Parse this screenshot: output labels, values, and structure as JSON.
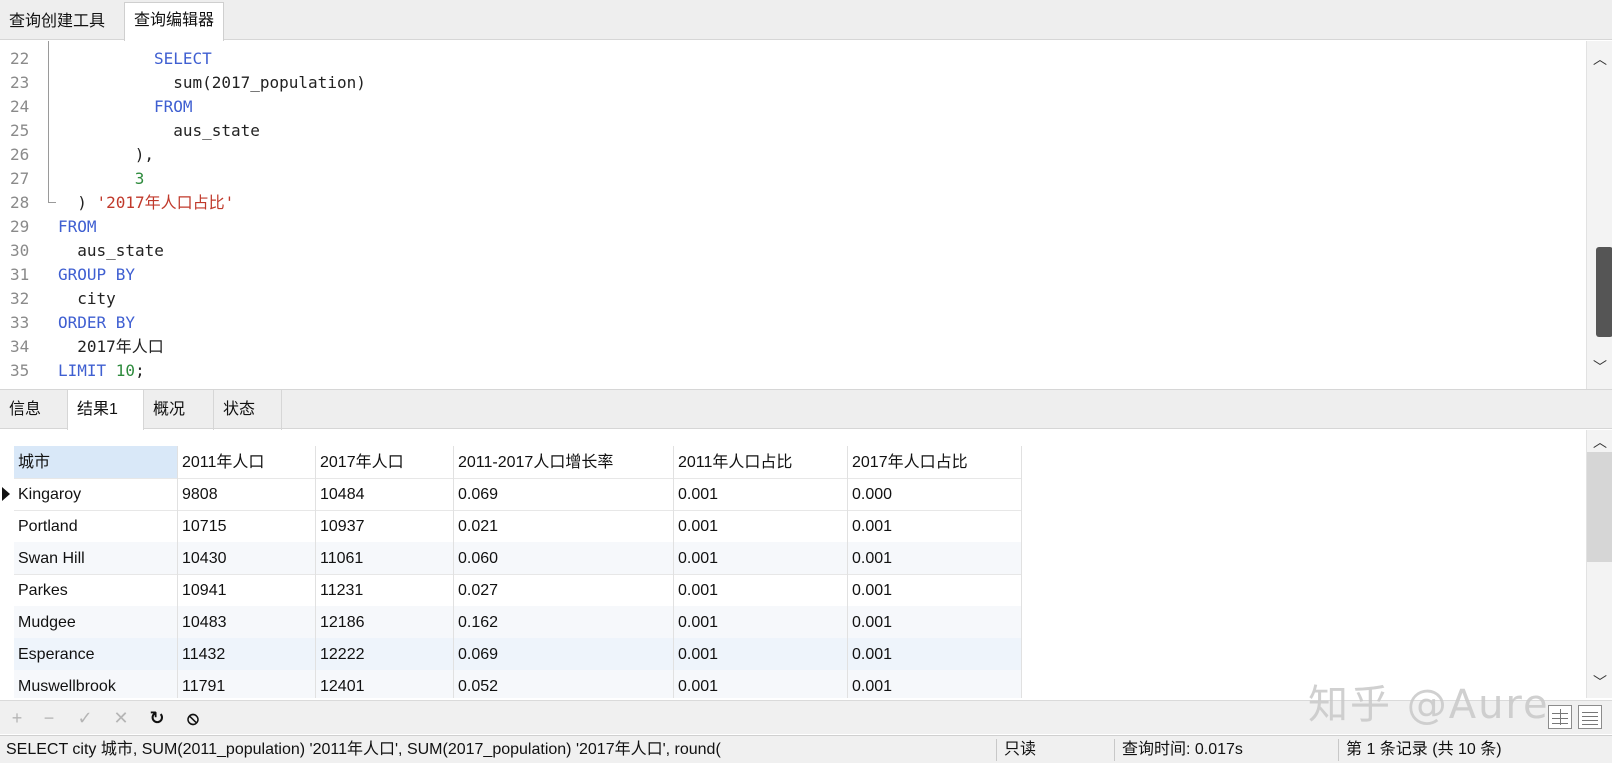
{
  "top_tabs": [
    "查询创建工具",
    "查询编辑器"
  ],
  "editor": {
    "lines": [
      {
        "n": "22",
        "indent": 5,
        "parts": [
          {
            "t": "SELECT",
            "c": "kw"
          }
        ]
      },
      {
        "n": "23",
        "indent": 6,
        "parts": [
          {
            "t": "sum(2017_population)",
            "c": ""
          }
        ]
      },
      {
        "n": "24",
        "indent": 5,
        "parts": [
          {
            "t": "FROM",
            "c": "kw"
          }
        ]
      },
      {
        "n": "25",
        "indent": 6,
        "parts": [
          {
            "t": "aus_state",
            "c": ""
          }
        ]
      },
      {
        "n": "26",
        "indent": 4,
        "parts": [
          {
            "t": "),",
            "c": ""
          }
        ]
      },
      {
        "n": "27",
        "indent": 4,
        "parts": [
          {
            "t": "3",
            "c": "num"
          }
        ]
      },
      {
        "n": "28",
        "indent": 1,
        "parts": [
          {
            "t": ") ",
            "c": ""
          },
          {
            "t": "'2017年人口占比'",
            "c": "str"
          }
        ]
      },
      {
        "n": "29",
        "indent": 0,
        "parts": [
          {
            "t": "FROM",
            "c": "kw"
          }
        ]
      },
      {
        "n": "30",
        "indent": 1,
        "parts": [
          {
            "t": "aus_state",
            "c": ""
          }
        ]
      },
      {
        "n": "31",
        "indent": 0,
        "parts": [
          {
            "t": "GROUP BY",
            "c": "kw"
          }
        ]
      },
      {
        "n": "32",
        "indent": 1,
        "parts": [
          {
            "t": "city",
            "c": ""
          }
        ]
      },
      {
        "n": "33",
        "indent": 0,
        "parts": [
          {
            "t": "ORDER BY",
            "c": "kw"
          }
        ]
      },
      {
        "n": "34",
        "indent": 1,
        "parts": [
          {
            "t": "2017年人口",
            "c": ""
          }
        ]
      },
      {
        "n": "35",
        "indent": 0,
        "parts": [
          {
            "t": "LIMIT ",
            "c": "kw"
          },
          {
            "t": "10",
            "c": "num"
          },
          {
            "t": ";",
            "c": ""
          }
        ]
      }
    ]
  },
  "result_tabs": [
    "信息",
    "结果1",
    "概况",
    "状态"
  ],
  "active_result_tab": "结果1",
  "grid": {
    "columns": [
      "城市",
      "2011年人口",
      "2017年人口",
      "2011-2017人口增长率",
      "2011年人口占比",
      "2017年人口占比"
    ],
    "rows": [
      [
        "Kingaroy",
        "9808",
        "10484",
        "0.069",
        "0.001",
        "0.000"
      ],
      [
        "Portland",
        "10715",
        "10937",
        "0.021",
        "0.001",
        "0.001"
      ],
      [
        "Swan Hill",
        "10430",
        "11061",
        "0.060",
        "0.001",
        "0.001"
      ],
      [
        "Parkes",
        "10941",
        "11231",
        "0.027",
        "0.001",
        "0.001"
      ],
      [
        "Mudgee",
        "10483",
        "12186",
        "0.162",
        "0.001",
        "0.001"
      ],
      [
        "Esperance",
        "11432",
        "12222",
        "0.069",
        "0.001",
        "0.001"
      ],
      [
        "Muswellbrook",
        "11791",
        "12401",
        "0.052",
        "0.001",
        "0.001"
      ]
    ]
  },
  "toolbar": {
    "icons": [
      "plus-icon",
      "minus-icon",
      "check-icon",
      "cross-icon",
      "refresh-icon",
      "stop-icon"
    ],
    "glyphs": [
      "+",
      "−",
      "✓",
      "✕",
      "↻",
      "⦸"
    ]
  },
  "watermark": "知乎 @Aure",
  "status": {
    "sql": "SELECT   city 城市,  SUM(2011_population) '2011年人口',    SUM(2017_population) '2017年人口',    round(",
    "mode": "只读",
    "query_time": "查询时间: 0.017s",
    "records": "第 1 条记录 (共 10 条)"
  }
}
